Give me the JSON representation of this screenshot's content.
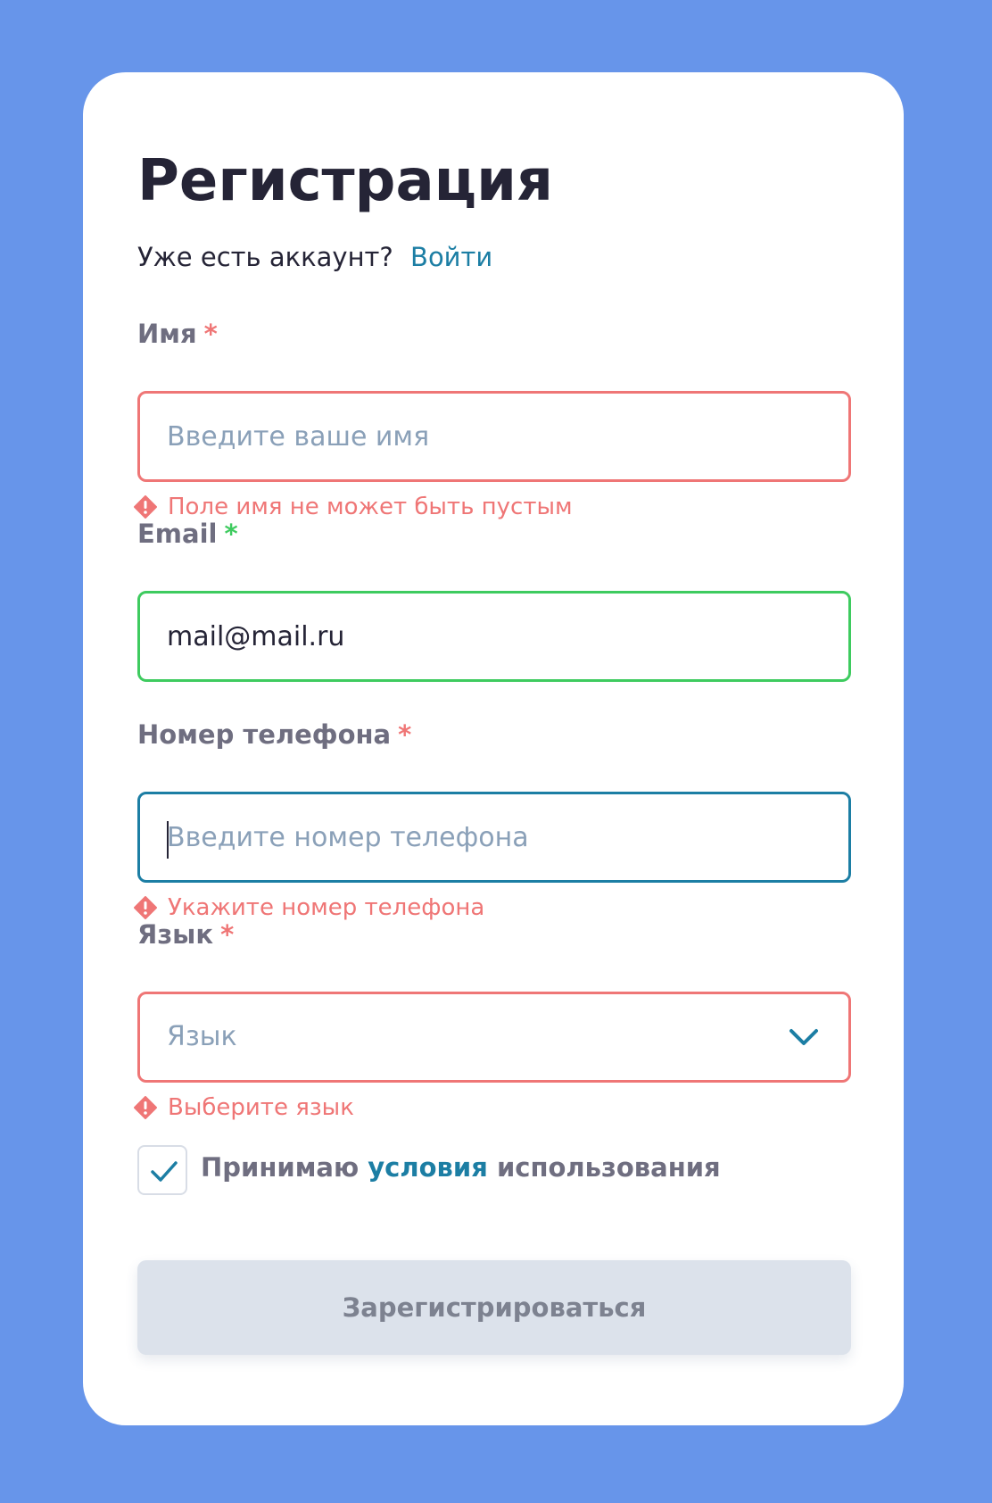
{
  "form": {
    "title": "Регистрация",
    "subtitle_text": "Уже есть аккаунт?",
    "login_link": "Войти",
    "required_mark": "*",
    "name": {
      "label": "Имя",
      "placeholder": "Введите ваше имя",
      "value": "",
      "status": "error",
      "error": "Поле имя не может быть пустым"
    },
    "email": {
      "label": "Email",
      "value": "mail@mail.ru",
      "status": "valid"
    },
    "phone": {
      "label": "Номер телефона",
      "placeholder": "Введите номер телефона",
      "value": "",
      "status": "focused",
      "error": "Укажите номер телефона"
    },
    "language": {
      "label": "Язык",
      "placeholder": "Язык",
      "status": "error",
      "error": "Выберите язык"
    },
    "terms": {
      "checked": true,
      "prefix": "Принимаю",
      "link": "условия",
      "suffix": "использования"
    },
    "submit_label": "Зарегистрироваться",
    "submit_enabled": false
  },
  "colors": {
    "background": "#6795ea",
    "card": "#ffffff",
    "error": "#ef7676",
    "success": "#3ecb5f",
    "accent": "#1c7ea4",
    "button_disabled": "#dce2eb"
  },
  "icons": {
    "error": "exclamation-diamond-icon",
    "select": "chevron-down-icon",
    "checkbox": "checkmark-icon"
  }
}
